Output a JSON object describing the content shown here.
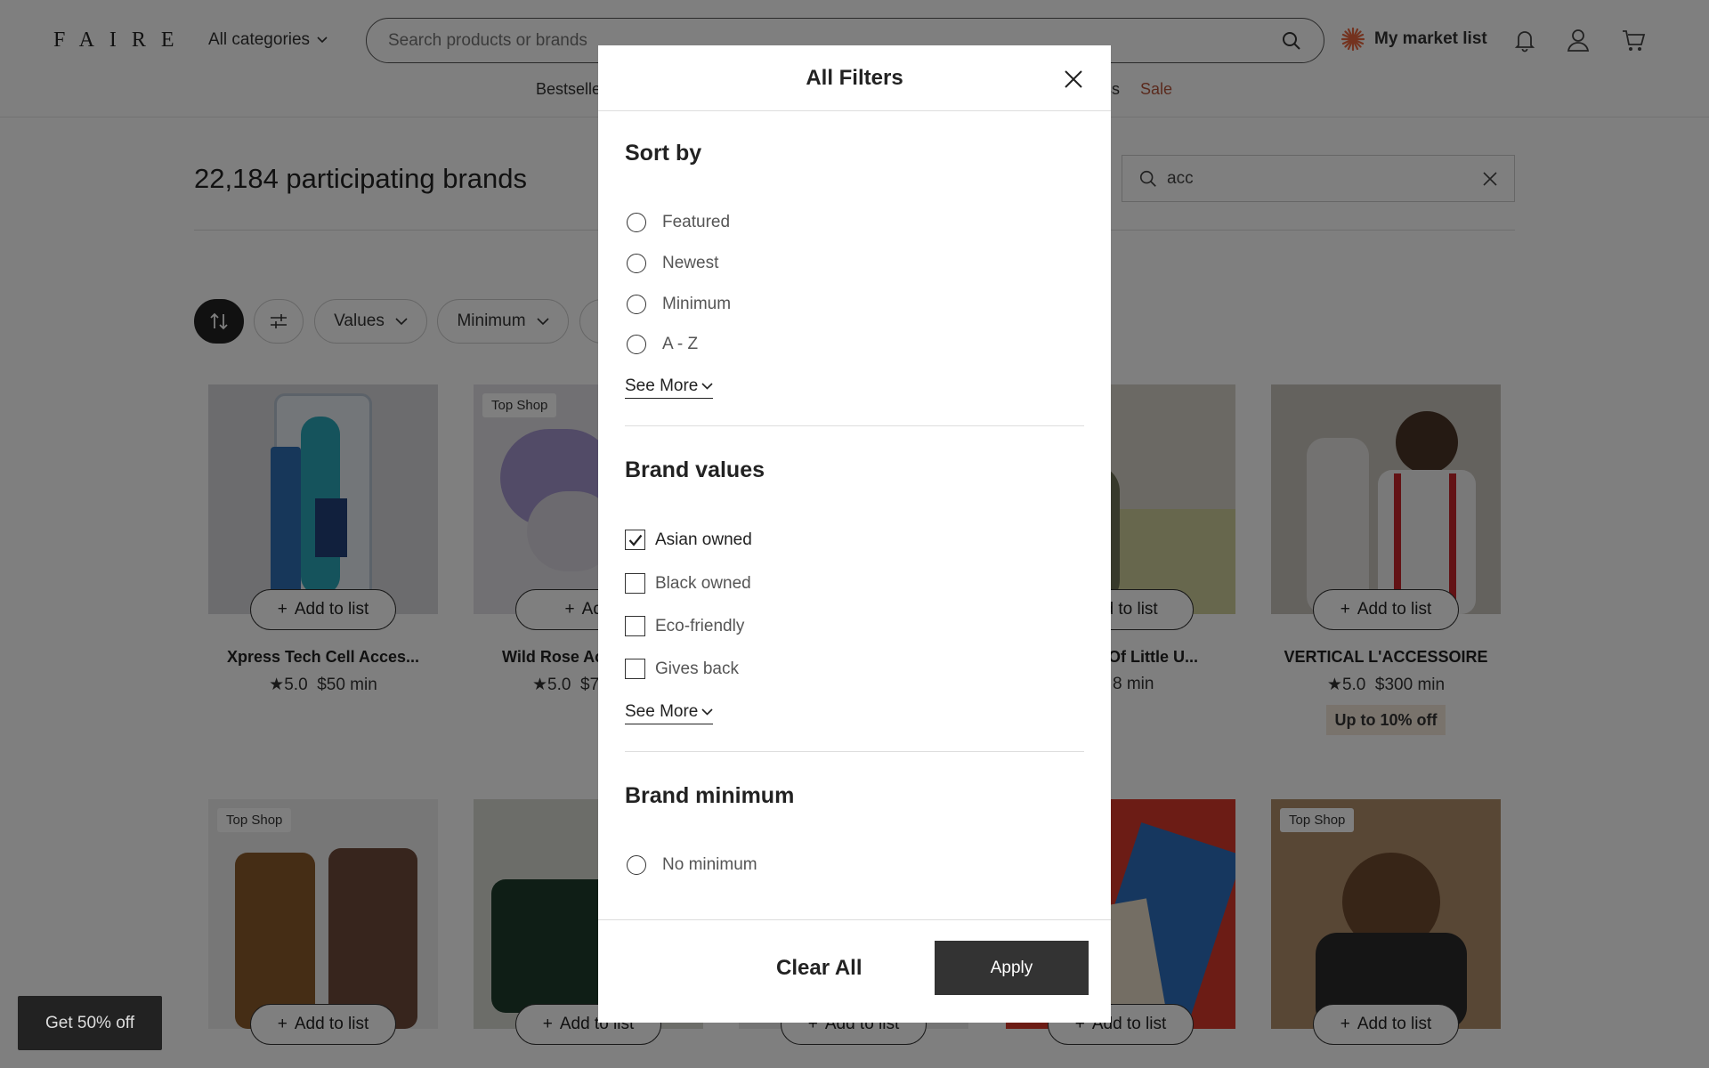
{
  "header": {
    "logo": "FAIRE",
    "categories_label": "All categories",
    "search_placeholder": "Search products or brands",
    "market_list_label": "My market list",
    "nav": [
      "Bestsellers",
      "ss",
      "Sale"
    ]
  },
  "page": {
    "brand_count": "22,184 participating brands",
    "brand_search_value": "acc",
    "filters": [
      "Values",
      "Minimum"
    ]
  },
  "products_row1": [
    {
      "name": "Xpress Tech Cell Acces...",
      "rating": "5.0",
      "min": "$50 min",
      "badge": "",
      "promo": ""
    },
    {
      "name": "Wild Rose Ac",
      "rating": "5.0",
      "min": "$7",
      "badge": "Top Shop",
      "promo": ""
    },
    {
      "name": "e Of Little U...",
      "rating": "",
      "min": "8 min",
      "badge": "",
      "promo": ""
    },
    {
      "name": "VERTICAL L'ACCESSOIRE",
      "rating": "5.0",
      "min": "$300 min",
      "badge": "",
      "promo": "Up to 10% off"
    }
  ],
  "products_row2": [
    {
      "badge": "Top Shop"
    },
    {
      "badge": ""
    },
    {
      "badge": ""
    },
    {
      "badge": ""
    },
    {
      "badge": "Top Shop"
    }
  ],
  "add_to_list": "Add to list",
  "add_partial": "Add",
  "modal": {
    "title": "All Filters",
    "sort_title": "Sort by",
    "sort_options": [
      "Featured",
      "Newest",
      "Minimum",
      "A - Z"
    ],
    "see_more": "See More",
    "values_title": "Brand values",
    "values_options": [
      "Asian owned",
      "Black owned",
      "Eco-friendly",
      "Gives back"
    ],
    "minimum_title": "Brand minimum",
    "minimum_options": [
      "No minimum"
    ],
    "clear_label": "Clear All",
    "apply_label": "Apply"
  },
  "promo_bar": "Get 50% off",
  "colors": {
    "sale": "#b5543a",
    "apply_bg": "#333333",
    "promo_tag": "#f2e6d9"
  }
}
